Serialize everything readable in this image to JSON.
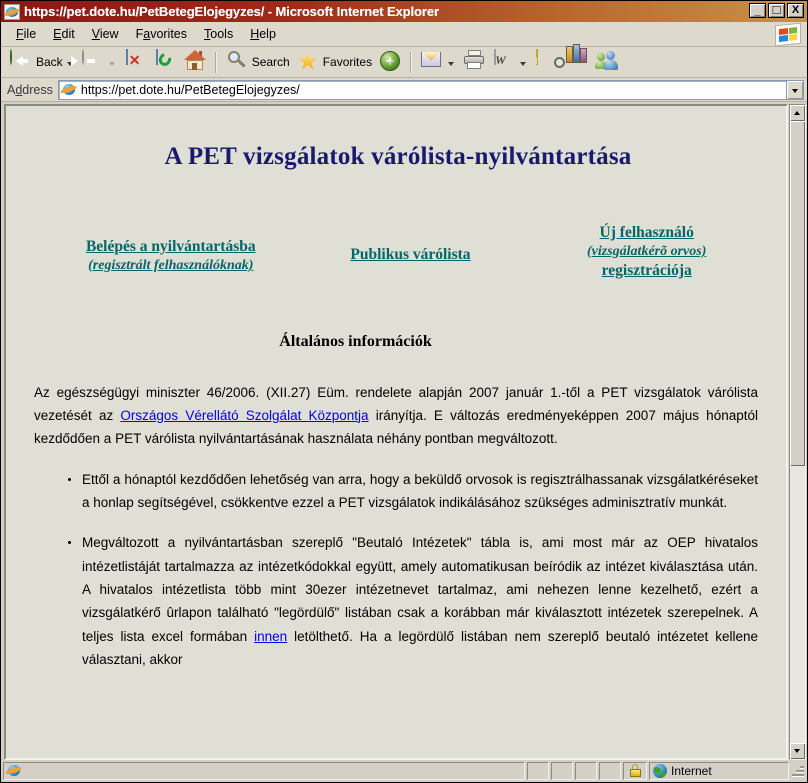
{
  "window": {
    "title": "https://pet.dote.hu/PetBetegElojegyzes/ - Microsoft Internet Explorer",
    "minimize_label": "_",
    "maximize_label": "□",
    "close_label": "X",
    "app_icon": "ie-icon"
  },
  "menu": {
    "items": [
      {
        "label": "File",
        "accel": "F",
        "rest": "ile"
      },
      {
        "label": "Edit",
        "accel": "E",
        "rest": "dit"
      },
      {
        "label": "View",
        "accel": "V",
        "rest": "iew"
      },
      {
        "label": "Favorites",
        "accel": "F",
        "rest": "avorites"
      },
      {
        "label": "Tools",
        "accel": "T",
        "rest": "ools"
      },
      {
        "label": "Help",
        "accel": "H",
        "rest": "elp"
      }
    ],
    "brand_icon": "windows-flag-icon"
  },
  "toolbar": {
    "back_label": "Back",
    "search_label": "Search",
    "favorites_label": "Favorites",
    "icons": [
      "back-icon",
      "forward-icon",
      "stop-icon",
      "refresh-icon",
      "home-icon",
      "search-icon",
      "favorites-star-icon",
      "media-icon",
      "mail-icon",
      "print-icon",
      "edit-word-icon",
      "note-icon",
      "research-icon",
      "messenger-icon"
    ]
  },
  "address": {
    "label": "Address",
    "label_accel": "A",
    "label_rest_1": "A",
    "label_rest_2": "ddress",
    "url": "https://pet.dote.hu/PetBetegElojegyzes/",
    "dropdown_icon": "chevron-down-icon",
    "site_icon": "ie-page-icon"
  },
  "page": {
    "title": "A PET vizsgálatok várólista-nyilvántartása",
    "links": [
      {
        "main": "Belépés a nyilvántartásba ",
        "sub": "(regisztrált felhasználóknak)",
        "third": ""
      },
      {
        "main": "Publikus várólista",
        "sub": "",
        "third": ""
      },
      {
        "main": "Új felhasználó",
        "sub": "(vizsgálatkérõ orvos)",
        "third": "regisztrációja"
      }
    ],
    "section_heading": "Általános információk",
    "intro": {
      "part1": "Az egészségügyi miniszter 46/2006. (XII.27) Eüm. rendelete alapján 2007 január 1.-től a PET vizsgálatok várólista vezetését az ",
      "link": "Országos Vérellátó Szolgálat Központja",
      "part2": " irányítja. E változás eredményeképpen 2007 május hónaptól kezdődően a PET várólista nyilvántartásának használata néhány pontban megváltozott."
    },
    "bullets": [
      {
        "text": "Ettől a hónaptól kezdődően lehetőség van arra, hogy a beküldő orvosok is regisztrálhassanak vizsgálatkéréseket a honlap segítségével, csökkentve ezzel a PET vizsgálatok indikálásához szükséges  adminisztratív munkát."
      },
      {
        "part1": "Megváltozott a nyilvántartásban szereplő \"Beutaló Intézetek\" tábla is, ami most már az OEP hivatalos intézetlistáját tartalmazza az intézetkódokkal együtt, amely automatikusan beíródik az intézet kiválasztása után. A hivatalos intézetlista több mint 30ezer intézetnevet tartalmaz, ami nehezen lenne kezelhető, ezért a vizsgálatkérő ûrlapon található \"legördülő\" listában csak a korábban már kiválasztott intézetek szerepelnek. A teljes lista excel formában ",
        "link": "innen",
        "part2": " letölthető. Ha a legördülő listában nem szereplő beutaló intézetet kellene választani, akkor"
      }
    ]
  },
  "statusbar": {
    "zone_label": "Internet",
    "lock_icon": "secure-lock-icon",
    "zone_icon": "internet-globe-icon",
    "page_icon": "ie-page-icon",
    "resize_grip": "resize-grip-icon"
  },
  "colors": {
    "titlebar_left": "#8c1616",
    "titlebar_right": "#c8924b",
    "page_background": "#e0dfd5",
    "heading": "#191970",
    "nav_link": "#006666",
    "body_link": "#0000ee",
    "chrome": "#d4d0c8"
  }
}
